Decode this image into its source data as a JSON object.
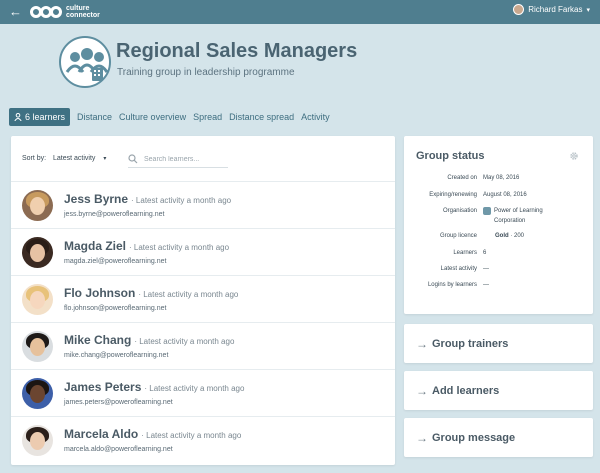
{
  "topbar": {
    "back_icon": "arrow-left-icon",
    "brand_line1": "culture",
    "brand_line2": "connector",
    "user_name": "Richard Farkas",
    "user_caret": "▾"
  },
  "group": {
    "title": "Regional Sales Managers",
    "subtitle": "Training group in leadership programme"
  },
  "tabs": [
    {
      "label": "6 learners",
      "active": true
    },
    {
      "label": "Distance"
    },
    {
      "label": "Culture overview"
    },
    {
      "label": "Spread"
    },
    {
      "label": "Distance spread"
    },
    {
      "label": "Activity"
    }
  ],
  "learners_panel": {
    "sort_label": "Sort by:",
    "sort_value": "Latest activity",
    "search_placeholder": "Search learners...",
    "learners": [
      {
        "name": "Jess Byrne",
        "activity": "· Latest activity a month ago",
        "email": "jess.byrne@poweroflearning.net"
      },
      {
        "name": "Magda Ziel",
        "activity": "· Latest activity a month ago",
        "email": "magda.ziel@poweroflearning.net"
      },
      {
        "name": "Flo Johnson",
        "activity": "· Latest activity a month ago",
        "email": "flo.johnson@poweroflearning.net"
      },
      {
        "name": "Mike Chang",
        "activity": "· Latest activity a month ago",
        "email": "mike.chang@poweroflearning.net"
      },
      {
        "name": "James Peters",
        "activity": "· Latest activity a month ago",
        "email": "james.peters@poweroflearning.net"
      },
      {
        "name": "Marcela Aldo",
        "activity": "· Latest activity a month ago",
        "email": "marcela.aldo@poweroflearning.net"
      }
    ]
  },
  "status": {
    "title": "Group status",
    "created_label": "Created on",
    "created_value": "May 08, 2016",
    "expiring_label": "Expiring/renewing",
    "expiring_value": "August 08, 2016",
    "org_label": "Organisation",
    "org_value": "Power of Learning Corporation",
    "licence_label": "Group licence",
    "licence_value": "Gold",
    "licence_count": "· 200",
    "learners_label": "Learners",
    "learners_value": "6",
    "latest_label": "Latest activity",
    "latest_value": "—",
    "logins_label": "Logins by learners",
    "logins_value": "—"
  },
  "actions": {
    "trainers": "Group trainers",
    "add_learners": "Add learners",
    "message": "Group message"
  },
  "colors": {
    "topbar": "#4f7e8f",
    "background": "#d4e4ea",
    "active_tab": "#3f7183"
  }
}
